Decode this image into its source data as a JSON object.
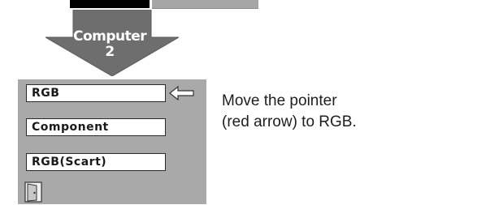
{
  "arrow": {
    "label_line1": "Computer",
    "label_line2": "2"
  },
  "menu": {
    "items": [
      {
        "label": "RGB",
        "selected": true
      },
      {
        "label": "Component",
        "selected": false
      },
      {
        "label": "RGB(Scart)",
        "selected": false
      }
    ],
    "pointer_icon": "left-arrow-pointer-icon",
    "exit_icon": "exit-door-icon"
  },
  "instruction": {
    "line1": "Move the pointer",
    "line2": "(red arrow) to RGB."
  },
  "colors": {
    "panel_bg": "#a9a9a9",
    "arrow_fill": "#6e6e6e",
    "item_bg": "#ffffff",
    "text": "#1e1e1e"
  }
}
